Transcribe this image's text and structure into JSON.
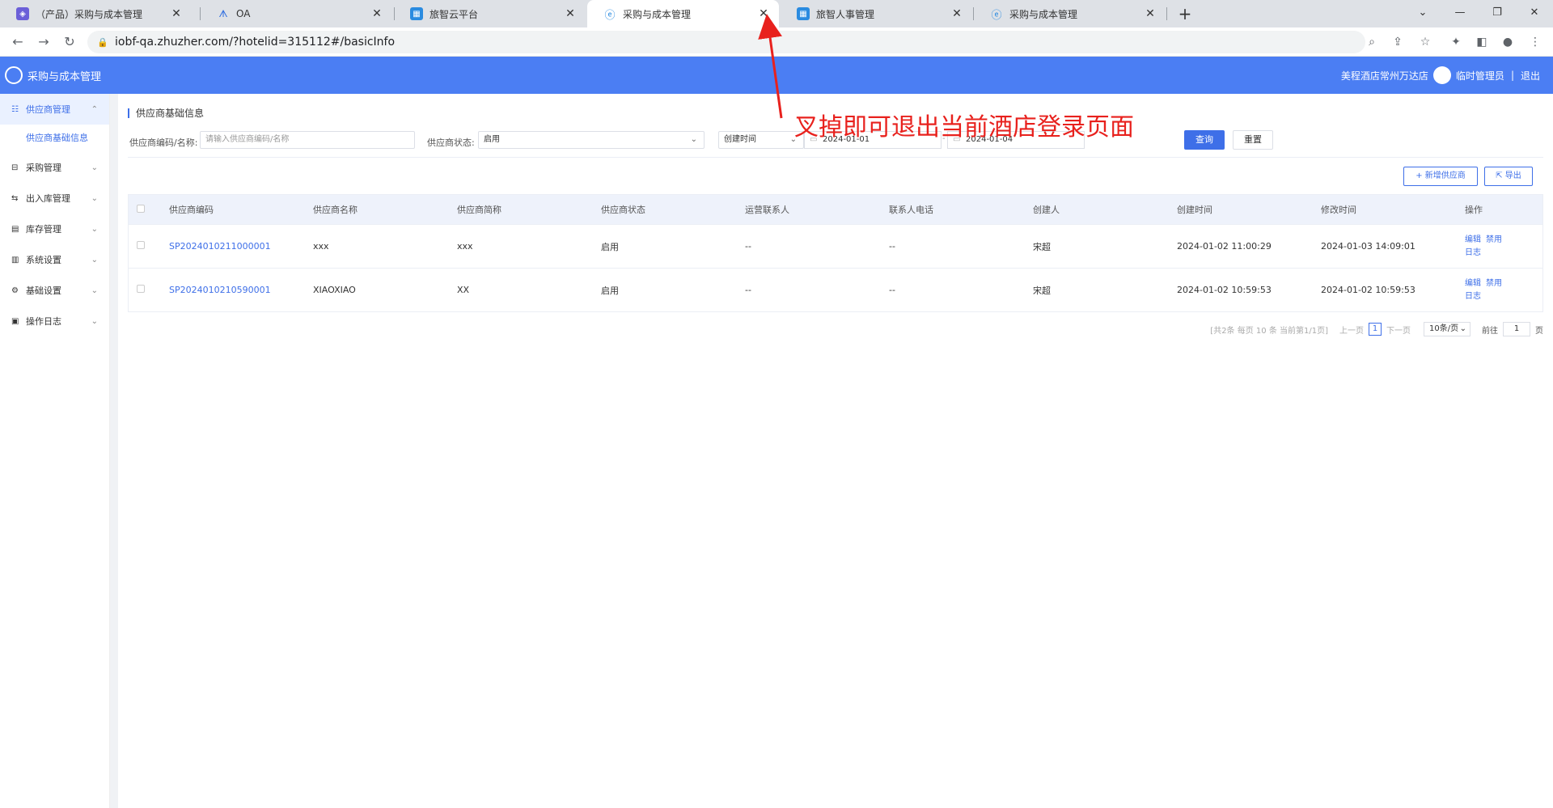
{
  "browser": {
    "tabs": [
      {
        "title": "（产品）采购与成本管理",
        "favicon_color": "#6b5fd8",
        "active": false
      },
      {
        "title": "OA",
        "favicon_color": "#2d6cdf",
        "active": false
      },
      {
        "title": "旅智云平台",
        "favicon_color": "#2a8be0",
        "active": false
      },
      {
        "title": "采购与成本管理",
        "favicon_color": "#2a8be0",
        "active": true
      },
      {
        "title": "旅智人事管理",
        "favicon_color": "#2a8be0",
        "active": false
      },
      {
        "title": "采购与成本管理",
        "favicon_color": "#2a8be0",
        "active": false
      }
    ],
    "url": "iobf-qa.zhuzher.com/?hotelid=315112#/basicInfo"
  },
  "header": {
    "app_name": "采购与成本管理",
    "hotel": "美程酒店常州万达店",
    "user": "临时管理员",
    "separator": "|",
    "logout": "退出",
    "accent": "#4b7ef3"
  },
  "sidebar": {
    "groups": [
      {
        "label": "供应商管理",
        "icon": "supplier-icon",
        "chevron": "⌃",
        "active": true
      },
      {
        "label": "采购管理",
        "icon": "cart-icon",
        "chevron": "⌄"
      },
      {
        "label": "出入库管理",
        "icon": "warehouse-io-icon",
        "chevron": "⌄"
      },
      {
        "label": "库存管理",
        "icon": "inventory-icon",
        "chevron": "⌄"
      },
      {
        "label": "系统设置",
        "icon": "system-icon",
        "chevron": "⌄"
      },
      {
        "label": "基础设置",
        "icon": "gear-icon",
        "chevron": "⌄"
      },
      {
        "label": "操作日志",
        "icon": "log-icon",
        "chevron": "⌄"
      }
    ],
    "active_sub": "供应商基础信息"
  },
  "page": {
    "title": "供应商基础信息",
    "filters": {
      "code_label": "供应商编码/名称:",
      "code_placeholder": "请输入供应商编码/名称",
      "status_label": "供应商状态:",
      "status_value": "启用",
      "date_type": "创建时间",
      "date_start": "2024-01-01",
      "date_sep": "-",
      "date_end": "2024-01-04",
      "query_btn": "查询",
      "reset_btn": "重置"
    },
    "actions": {
      "add_supplier": "新增供应商",
      "add_icon": "+",
      "export": "导出",
      "export_icon": "⇱"
    },
    "table": {
      "headers": [
        "供应商编码",
        "供应商名称",
        "供应商简称",
        "供应商状态",
        "运营联系人",
        "联系人电话",
        "创建人",
        "创建时间",
        "修改时间",
        "操作"
      ],
      "rows": [
        {
          "code": "SP2024010211000001",
          "name": "xxx",
          "short": "xxx",
          "status": "启用",
          "contact": "--",
          "phone": "--",
          "creator": "宋超",
          "created": "2024-01-02 11:00:29",
          "modified": "2024-01-03 14:09:01",
          "ops": [
            "编辑",
            "禁用",
            "日志"
          ]
        },
        {
          "code": "SP2024010210590001",
          "name": "XIAOXIAO",
          "short": "XX",
          "status": "启用",
          "contact": "--",
          "phone": "--",
          "creator": "宋超",
          "created": "2024-01-02 10:59:53",
          "modified": "2024-01-02 10:59:53",
          "ops": [
            "编辑",
            "禁用",
            "日志"
          ]
        }
      ]
    },
    "pager": {
      "summary": "[共2条 每页 10 条 当前第1/1页]",
      "prev": "上一页",
      "current": "1",
      "next": "下一页",
      "page_size": "10条/页",
      "goto_label": "前往",
      "goto_value": "1",
      "goto_unit": "页"
    }
  },
  "annotation": {
    "text": "叉掉即可退出当前酒店登录页面",
    "color": "#e8211d"
  }
}
